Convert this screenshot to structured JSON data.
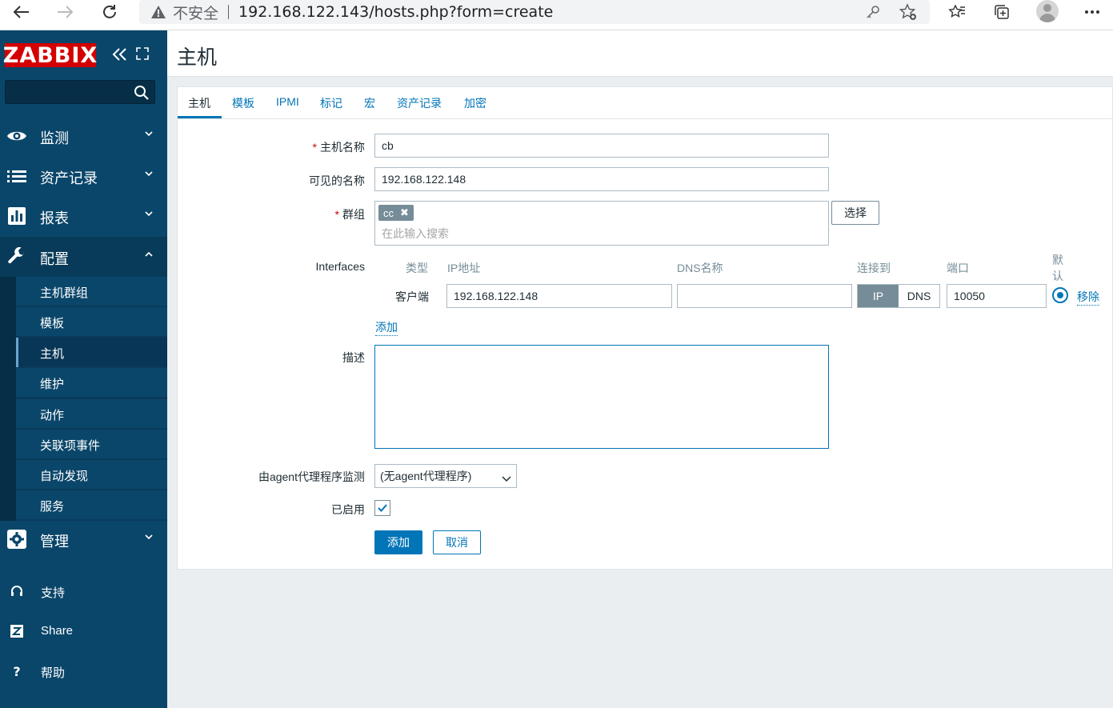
{
  "browser": {
    "insecure_label": "不安全",
    "url": "192.168.122.143/hosts.php?form=create"
  },
  "sidebar": {
    "logo": "ZABBIX",
    "search_placeholder": "",
    "menu": [
      {
        "label": "监测",
        "icon": "eye-icon"
      },
      {
        "label": "资产记录",
        "icon": "list-icon"
      },
      {
        "label": "报表",
        "icon": "chart-icon"
      },
      {
        "label": "配置",
        "icon": "wrench-icon"
      },
      {
        "label": "管理",
        "icon": "gear-icon"
      }
    ],
    "submenu": [
      "主机群组",
      "模板",
      "主机",
      "维护",
      "动作",
      "关联项事件",
      "自动发现",
      "服务"
    ],
    "footer": [
      {
        "label": "支持",
        "icon": "headset-icon"
      },
      {
        "label": "Share",
        "icon": "share-icon"
      },
      {
        "label": "帮助",
        "icon": "help-icon"
      }
    ]
  },
  "page": {
    "title": "主机"
  },
  "tabs": [
    "主机",
    "模板",
    "IPMI",
    "标记",
    "宏",
    "资产记录",
    "加密"
  ],
  "form": {
    "host_name_label": "主机名称",
    "host_name_value": "cb",
    "visible_name_label": "可见的名称",
    "visible_name_value": "192.168.122.148",
    "groups_label": "群组",
    "group_chip": "cc",
    "groups_placeholder": "在此输入搜索",
    "select_button": "选择",
    "interfaces_label": "Interfaces",
    "interfaces_headers": {
      "type": "类型",
      "ip": "IP地址",
      "dns": "DNS名称",
      "connect": "连接到",
      "port": "端口",
      "default_1": "默",
      "default_2": "认"
    },
    "interface_row": {
      "type": "客户端",
      "ip": "192.168.122.148",
      "dns": "",
      "connect_ip": "IP",
      "connect_dns": "DNS",
      "port": "10050",
      "remove": "移除"
    },
    "add_interface": "添加",
    "description_label": "描述",
    "description_value": "",
    "proxy_label": "由agent代理程序监测",
    "proxy_value": "(无agent代理程序)",
    "enabled_label": "已启用",
    "enabled": true,
    "add_button": "添加",
    "cancel_button": "取消"
  },
  "colors": {
    "sidebar": "#0a466a",
    "logo": "#d40000",
    "accent": "#0275b8"
  }
}
